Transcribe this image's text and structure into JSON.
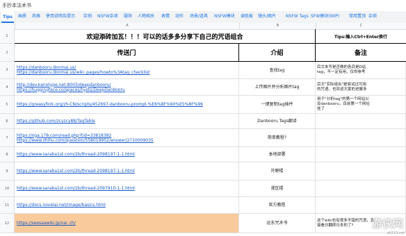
{
  "doc_title": "手抄本法术书",
  "tabs": [
    "Tips",
    "画质",
    "风格",
    "使用说明及提示",
    "实例",
    "NSFW杂项",
    "服饰",
    "人物相关",
    "表情",
    "动作",
    "场景/道具",
    "NSFW模块",
    "调色板",
    "镜头/图片",
    "NSFW Tags",
    "SFW模块(WIP)",
    "常用置顶",
    "杂项"
  ],
  "columns": [
    "A",
    "B",
    "C"
  ],
  "rows": [
    "1",
    "2",
    "3",
    "4",
    "5",
    "6",
    "7",
    "8",
    "9",
    "10",
    "11",
    "12"
  ],
  "banner": "欢迎添砖加瓦！！！可以的话多多分享下自己的咒语组合",
  "shortcut_tip": "Tips:输入Ctrl+Enter换行",
  "headers": {
    "a": "传送门",
    "b": "介绍",
    "c": "备注"
  },
  "entries": [
    {
      "links": [
        "https://danbooru.donmai.us/",
        "https://danbooru.donmai.us/wiki_pages/howto%3Atag_checklist"
      ],
      "intro": "查找tag",
      "note": [
        "后文末写是否做的各目是D站",
        "tag，不一定有用，仅供参考"
      ]
    },
    {
      "links": [
        "http://dev.kanotype.net:8003/deepdanbooru/",
        "https://huggingface.co/spaces/hysts/DeepDanbooru"
      ],
      "intro": "上传图片并分析图片tag",
      "note": [
        "后文\"实际组合\"是尝试过可用",
        "的咒语，也欢迎大家的进展多"
      ]
    },
    {
      "links": [
        "https://greasyfork.org/zh-CN/scripts/452697-danbooru-prompt-%E6%8F%90%E5%8F%96"
      ],
      "intro": "一键复制tag插件",
      "note": [
        "用于\"分析tag\"的第一个网站以",
        "及danbooru，目前第一个网址",
        "挂了"
      ]
    },
    {
      "links": [
        "https://github.com/zcyzcy88/TagTable"
      ],
      "intro": "Danbooru Tags翻译",
      "note": []
    },
    {
      "links": [
        "https://nga.178.com/read.php?tid=33818382",
        "https://www.zhihu.com/question/558019952/answer/2710009035"
      ],
      "intro": "简单教程?",
      "note": []
    },
    {
      "links": [
        "https://www.saraba1st.com/2b/thread-2098197-1-1.html"
      ],
      "intro": "本地部署",
      "note": []
    },
    {
      "links": [
        "https://www.saraba1st.com/2b/thread-2098197-1-1.html"
      ],
      "intro": "外野楼",
      "note": []
    },
    {
      "links": [
        "https://www.saraba1st.com/2b/thread-2097910-1-1.html"
      ],
      "intro": "漫区楼",
      "note": []
    },
    {
      "links": [
        "https://docs.novelai.net/image/basics.html"
      ],
      "intro": "官方教程",
      "note": []
    },
    {
      "links": [
        "https://seesaawiki.jp/nai_ch/"
      ],
      "intro": "远东咒术书",
      "note": [
        "这个wiki也有很多不错的咒语，直",
        "接看日翻即日本的了?"
      ]
    }
  ],
  "watermark": "游侠网",
  "watermark_sub": "ali213.net"
}
